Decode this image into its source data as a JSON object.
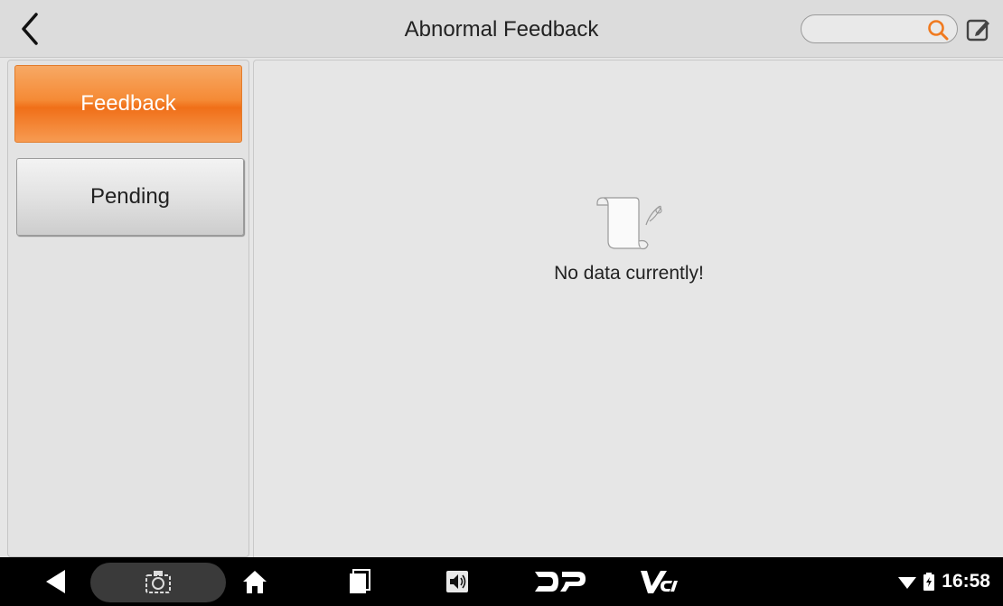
{
  "header": {
    "title": "Abnormal Feedback",
    "search_value": "",
    "search_placeholder": ""
  },
  "sidebar": {
    "items": [
      {
        "label": "Feedback",
        "active": true
      },
      {
        "label": "Pending",
        "active": false
      }
    ]
  },
  "main": {
    "empty_message": "No data currently!"
  },
  "statusbar": {
    "time": "16:58",
    "dp_label": "DP",
    "vci_label": "VCI"
  },
  "colors": {
    "accent": "#f58a35",
    "navbar": "#000000"
  },
  "icons": {
    "back": "chevron-left-icon",
    "search": "search-icon",
    "edit": "edit-icon",
    "empty": "empty-document-icon",
    "nav_back": "triangle-back-icon",
    "screenshot": "camera-icon",
    "home": "home-icon",
    "recents": "recents-icon",
    "volume": "volume-icon",
    "wifi": "wifi-icon",
    "battery": "battery-icon"
  }
}
